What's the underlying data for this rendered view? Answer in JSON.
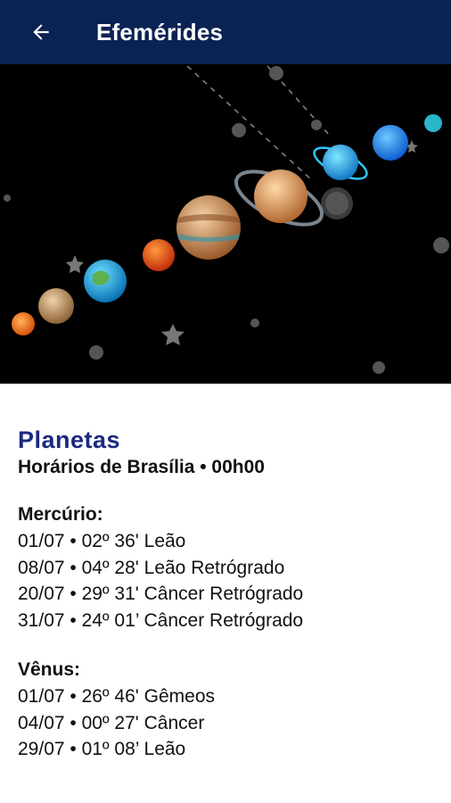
{
  "appbar": {
    "title": "Efemérides",
    "back_icon": "arrow-left-icon",
    "background": "#0b2352"
  },
  "hero": {
    "description_icon": "solar-system-illustration"
  },
  "content": {
    "section_title": "Planetas",
    "subtitle": "Horários de Brasília • 00h00",
    "planets": [
      {
        "name": "Mercúrio:",
        "entries": [
          "01/07 • 02º 36' Leão",
          "08/07 • 04º 28' Leão Retrógrado",
          "20/07 • 29º 31' Câncer Retrógrado",
          "31/07 • 24º 01’ Câncer Retrógrado"
        ]
      },
      {
        "name": "Vênus:",
        "entries": [
          "01/07 • 26º 46' Gêmeos",
          "04/07 • 00º 27' Câncer",
          "29/07 • 01º 08’ Leão"
        ]
      }
    ]
  }
}
